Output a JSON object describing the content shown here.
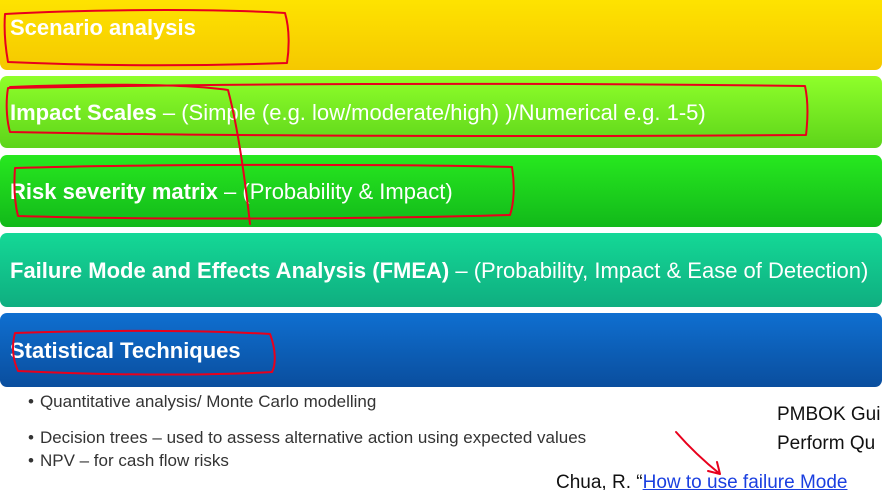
{
  "bands": [
    {
      "title": "Scenario analysis",
      "detail": ""
    },
    {
      "title": "Impact Scales",
      "detail": " – (Simple (e.g. low/moderate/high) )/Numerical e.g. 1-5)"
    },
    {
      "title": "Risk severity matrix",
      "detail": " – (Probability & Impact)"
    },
    {
      "title": "Failure Mode and Effects Analysis (FMEA)",
      "detail": " – (Probability, Impact & Ease of Detection)"
    },
    {
      "title": "Statistical Techniques",
      "detail": ""
    }
  ],
  "bullets": [
    "Quantitative analysis/ Monte Carlo modelling",
    "Decision trees – used to assess alternative action using expected values",
    "NPV – for cash flow risks"
  ],
  "side_note": {
    "line1": "PMBOK Gui",
    "line2": "Perform Qu"
  },
  "citation": {
    "prefix": "Chua, R. “",
    "link_text": "How to use failure Mode"
  },
  "colors": {
    "band1": "#f5c800",
    "band2": "#5dd41a",
    "band3": "#12b91a",
    "band4": "#0fae80",
    "band5": "#0a4e9e",
    "annotation": "#e8001c",
    "link": "#1a3fe0"
  }
}
